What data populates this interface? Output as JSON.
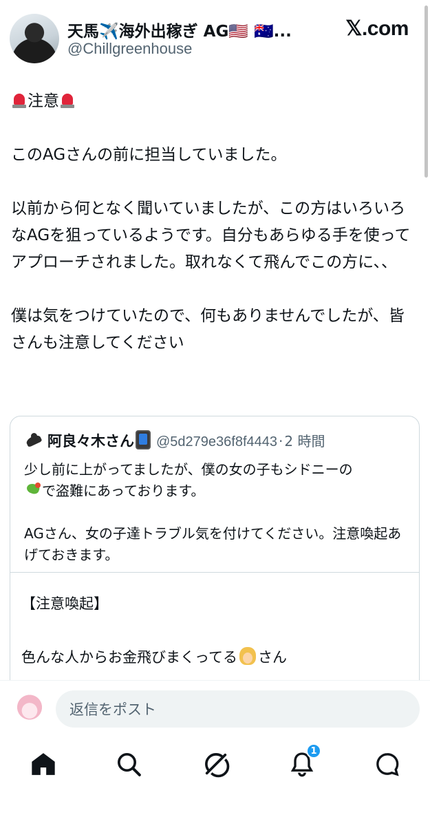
{
  "post": {
    "author_name": "天馬✈️海外出稼ぎ AG🇺🇸 🇦🇺...",
    "author_handle": "@Chillgreenhouse",
    "site_logo": "𝕏.com",
    "heading": "注意",
    "paragraphs": [
      "このAGさんの前に担当していました。",
      "以前から何となく聞いていましたが、この方はいろいろなAGを狙っているようです。自分もあらゆる手を使ってアプローチされました。取れなくて飛んでこの方に、、",
      "僕は気をつけていたので、何もありませんでしたが、皆さんも注意してください"
    ]
  },
  "quote": {
    "author_name": "阿良々木さん",
    "author_handle": "@5d279e36f8f4443",
    "separator": "·",
    "time": "2 時間",
    "text_line1": "少し前に上がってましたが、僕の女の子もシドニーの",
    "text_line2": "で盗難にあっております。",
    "text_para2": "AGさん、女の子達トラブル気を付けてください。注意喚起あげておきます。",
    "section_heading": "【注意喚起】",
    "section_text_before": "色んな人からお金飛びまくってる",
    "section_text_after": "さん"
  },
  "reply": {
    "placeholder": "返信をポスト"
  },
  "nav": {
    "notification_count": "1",
    "icons": [
      "home-icon",
      "search-icon",
      "grok-icon",
      "bell-icon",
      "messages-icon"
    ]
  },
  "colors": {
    "text": "#0f1419",
    "secondary": "#536471",
    "accent": "#1d9bf0",
    "border": "#cfd9de"
  }
}
